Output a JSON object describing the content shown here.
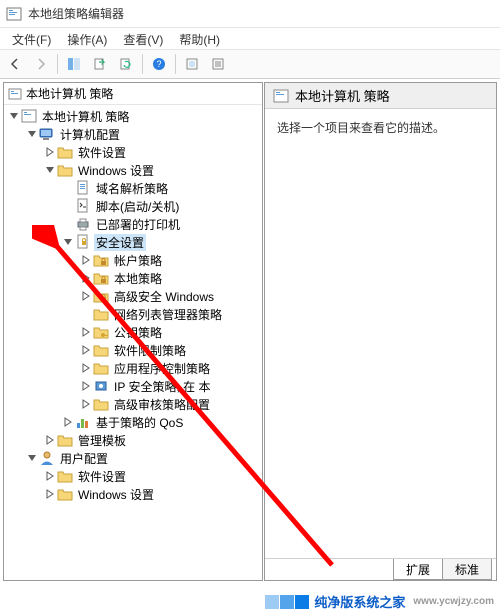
{
  "window": {
    "title": "本地组策略编辑器"
  },
  "menu": [
    "文件(F)",
    "操作(A)",
    "查看(V)",
    "帮助(H)"
  ],
  "tree_header": "本地计算机 策略",
  "tree": [
    {
      "indent": 0,
      "twisty": "open",
      "icon": "root",
      "label": "本地计算机 策略"
    },
    {
      "indent": 1,
      "twisty": "open",
      "icon": "computer",
      "label": "计算机配置"
    },
    {
      "indent": 2,
      "twisty": "closed",
      "icon": "folder",
      "label": "软件设置"
    },
    {
      "indent": 2,
      "twisty": "open",
      "icon": "folder",
      "label": "Windows 设置"
    },
    {
      "indent": 3,
      "twisty": "none",
      "icon": "doc",
      "label": "域名解析策略"
    },
    {
      "indent": 3,
      "twisty": "none",
      "icon": "script",
      "label": "脚本(启动/关机)"
    },
    {
      "indent": 3,
      "twisty": "none",
      "icon": "printer",
      "label": "已部署的打印机"
    },
    {
      "indent": 3,
      "twisty": "open",
      "icon": "security",
      "label": "安全设置",
      "selected": true
    },
    {
      "indent": 4,
      "twisty": "closed",
      "icon": "folderlock",
      "label": "帐户策略"
    },
    {
      "indent": 4,
      "twisty": "closed",
      "icon": "folderlock",
      "label": "本地策略"
    },
    {
      "indent": 4,
      "twisty": "closed",
      "icon": "folderlock",
      "label": "高级安全 Windows"
    },
    {
      "indent": 4,
      "twisty": "none",
      "icon": "folder",
      "label": "网络列表管理器策略"
    },
    {
      "indent": 4,
      "twisty": "closed",
      "icon": "folderkey",
      "label": "公钥策略"
    },
    {
      "indent": 4,
      "twisty": "closed",
      "icon": "folder",
      "label": "软件限制策略"
    },
    {
      "indent": 4,
      "twisty": "closed",
      "icon": "folder",
      "label": "应用程序控制策略"
    },
    {
      "indent": 4,
      "twisty": "closed",
      "icon": "ipsec",
      "label": "IP 安全策略, 在 本"
    },
    {
      "indent": 4,
      "twisty": "closed",
      "icon": "folder",
      "label": "高级审核策略配置"
    },
    {
      "indent": 3,
      "twisty": "closed",
      "icon": "chart",
      "label": "基于策略的 QoS"
    },
    {
      "indent": 2,
      "twisty": "closed",
      "icon": "folder",
      "label": "管理模板"
    },
    {
      "indent": 1,
      "twisty": "open",
      "icon": "user",
      "label": "用户配置"
    },
    {
      "indent": 2,
      "twisty": "closed",
      "icon": "folder",
      "label": "软件设置"
    },
    {
      "indent": 2,
      "twisty": "closed",
      "icon": "folder",
      "label": "Windows 设置"
    }
  ],
  "right": {
    "header": "本地计算机 策略",
    "body": "选择一个项目来查看它的描述。",
    "tabs": [
      "扩展",
      "标准"
    ],
    "active_tab": 0
  },
  "watermark": {
    "text": "纯净版系统之家",
    "url": "www.ycwjzy.com"
  }
}
